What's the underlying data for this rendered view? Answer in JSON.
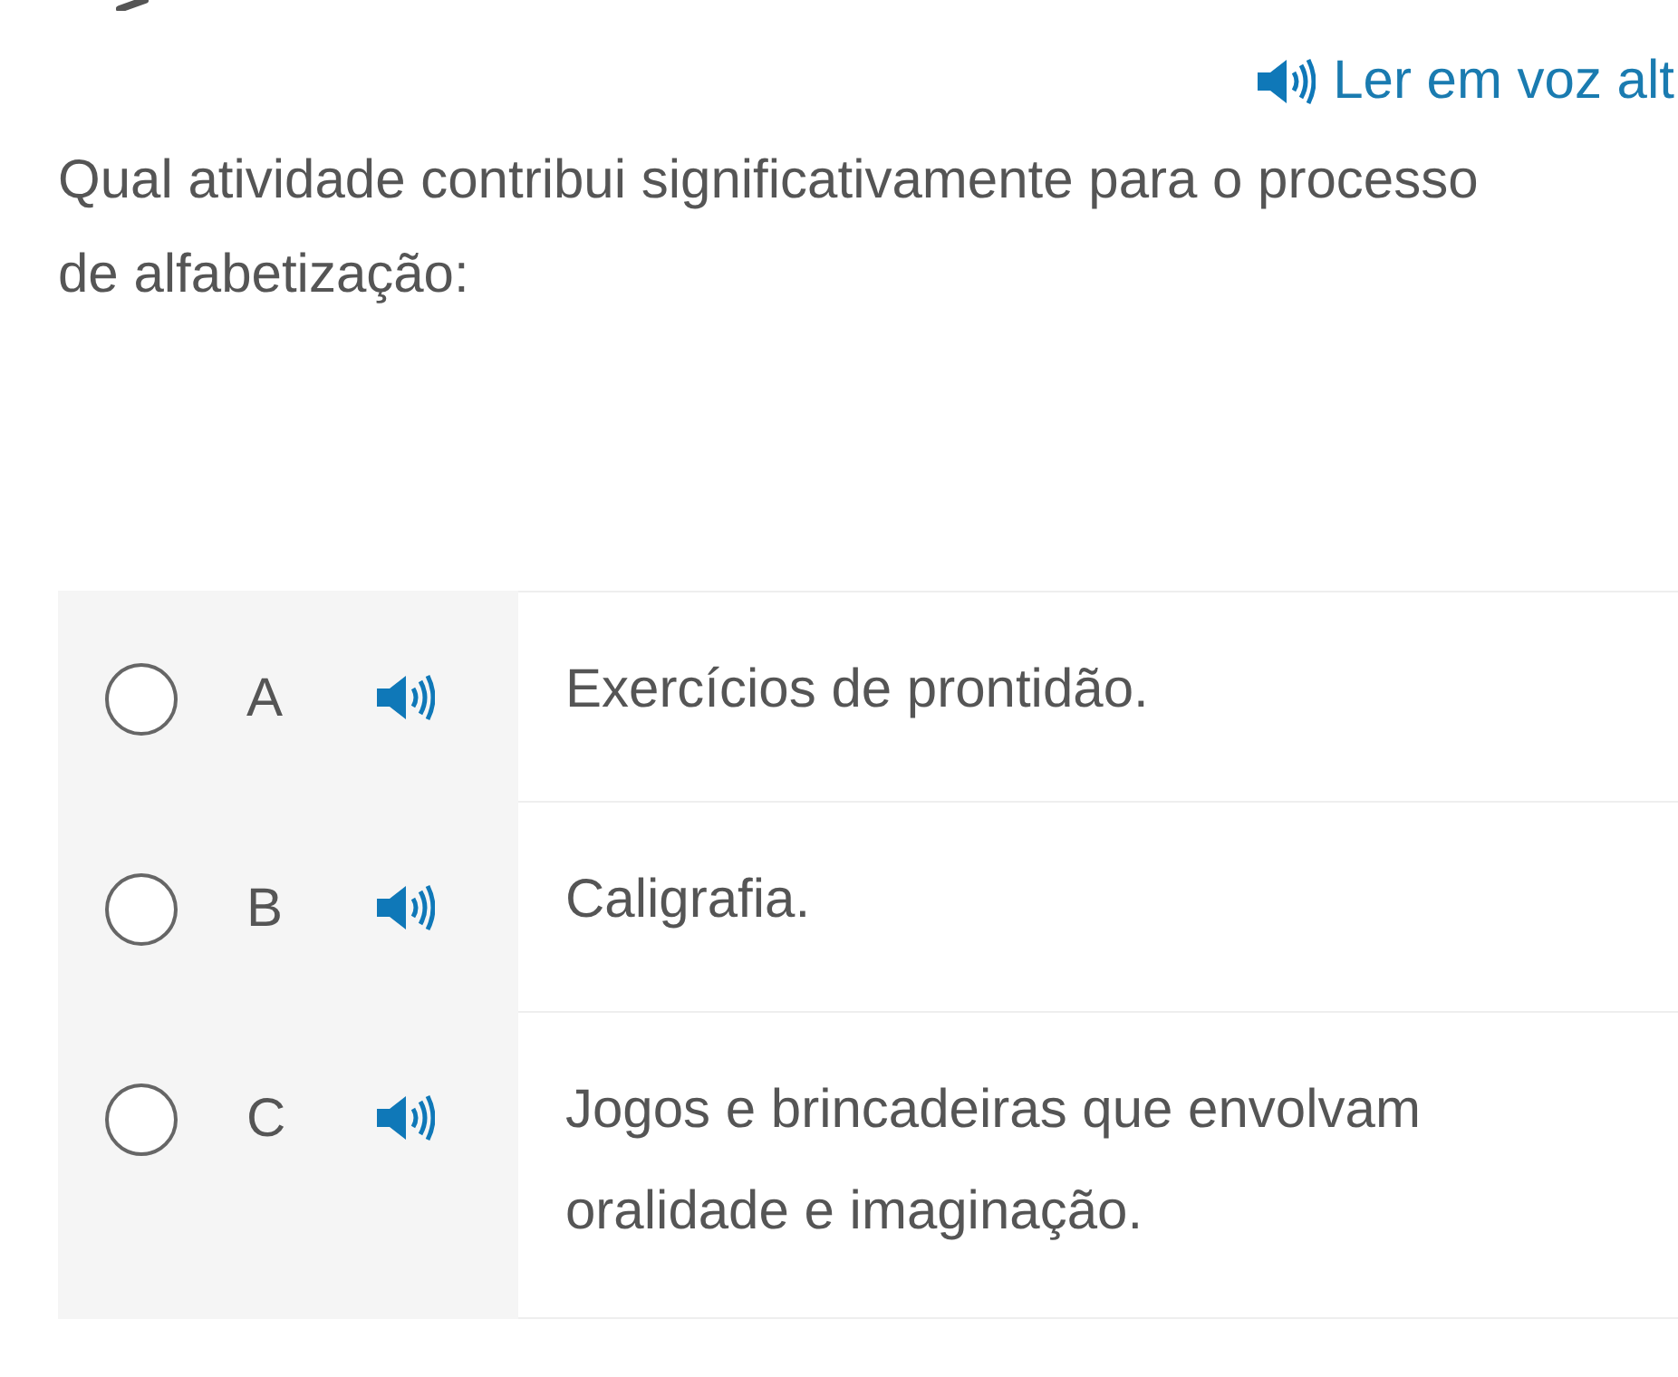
{
  "read_aloud": {
    "label": "Ler em voz alt"
  },
  "question": "Qual atividade contribui significativamente para o processo de alfabetização:",
  "options": [
    {
      "letter": "A",
      "text": "Exercícios de prontidão.",
      "selected": false
    },
    {
      "letter": "B",
      "text": "Caligrafia.",
      "selected": false
    },
    {
      "letter": "C",
      "text": "Jogos e brincadeiras que envolvam oralidade e imaginação.",
      "selected": false
    }
  ]
}
